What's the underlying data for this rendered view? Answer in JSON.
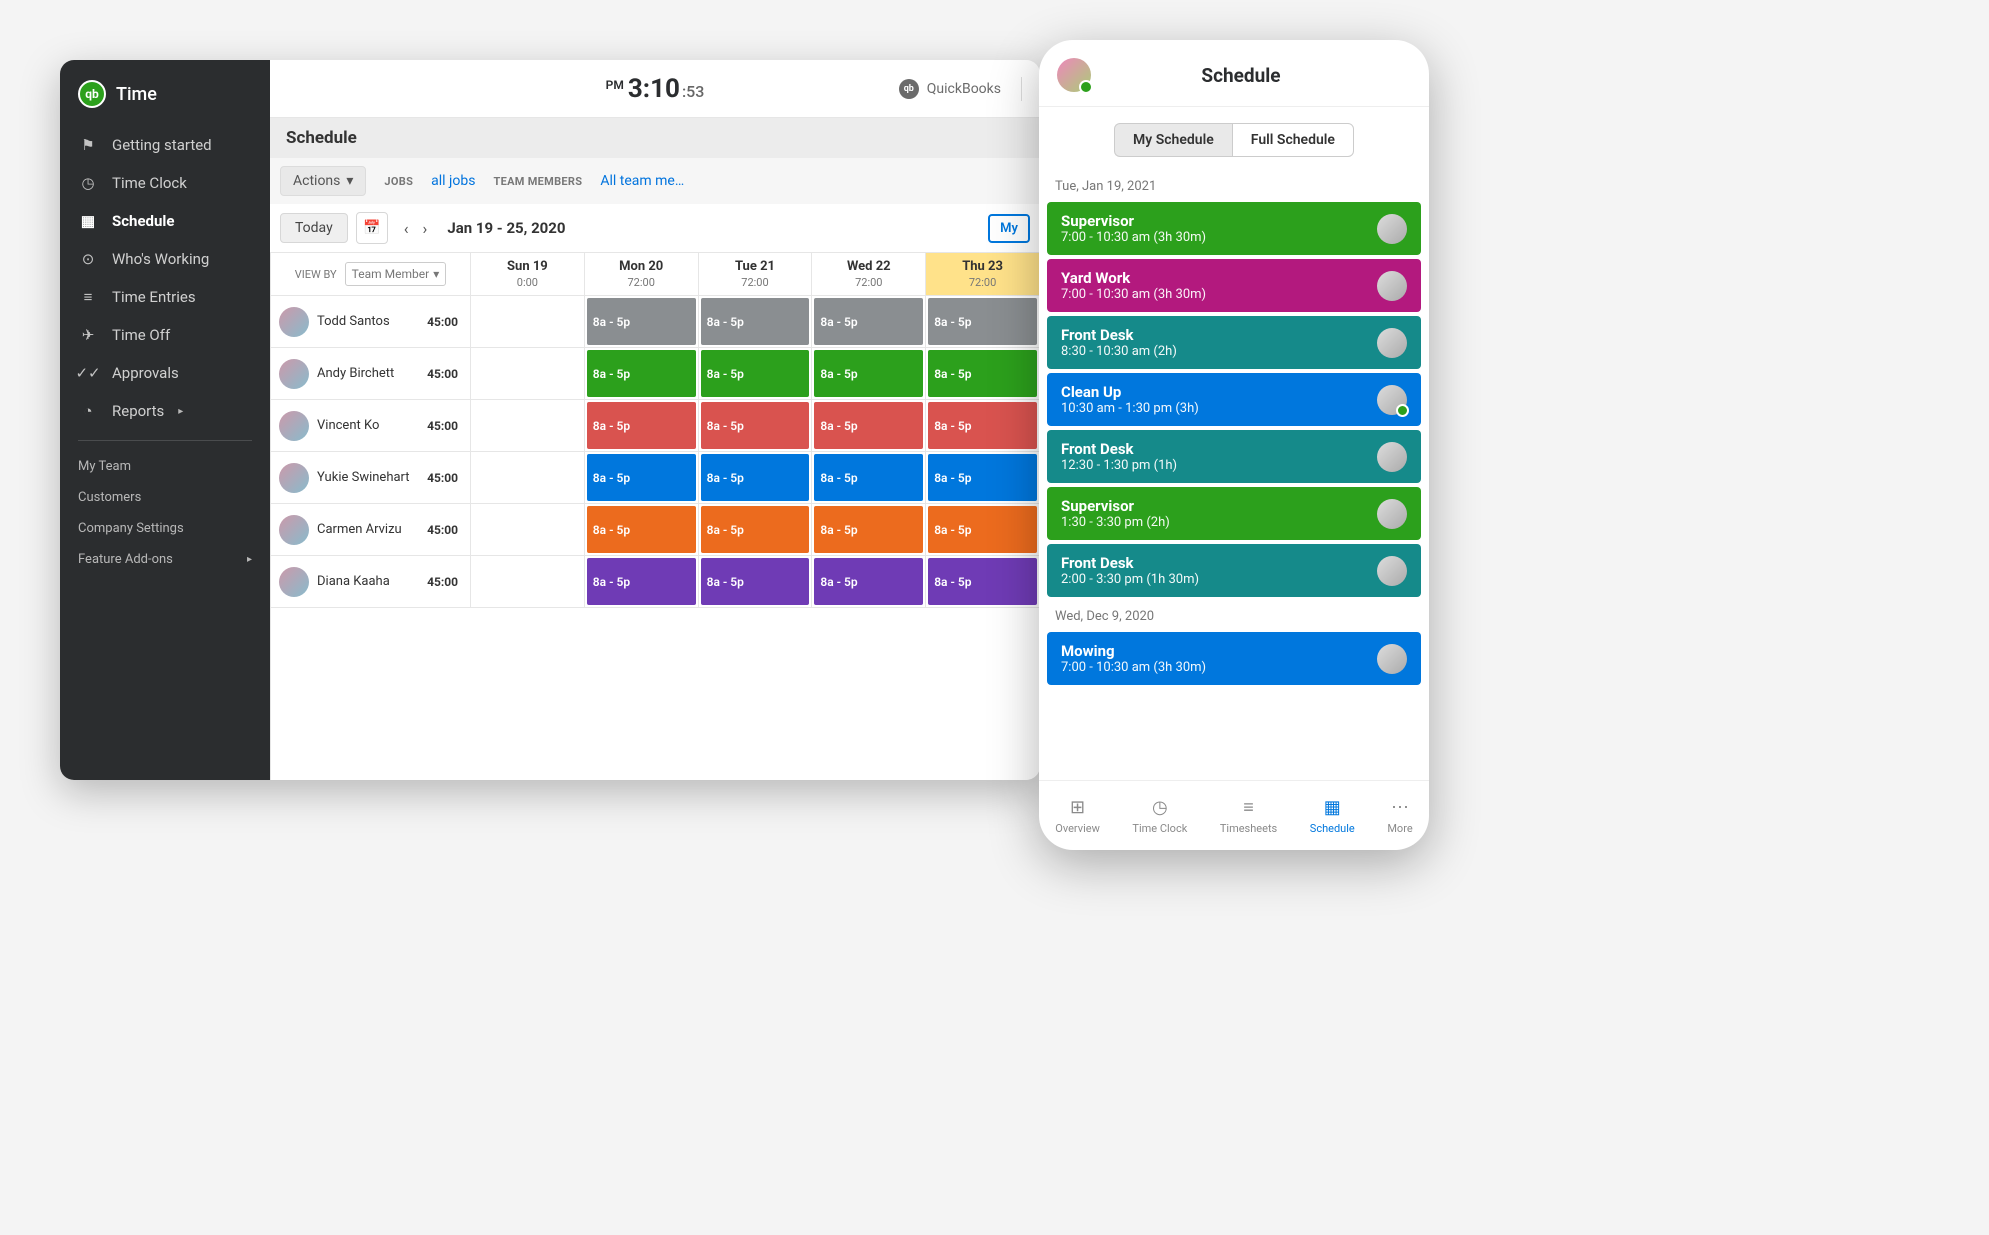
{
  "brand": {
    "name": "Time",
    "badge": "qb"
  },
  "clock": {
    "ampm": "PM",
    "hhmm": "3:10",
    "ss": ":53"
  },
  "topRight": {
    "label": "QuickBooks",
    "badge": "qb"
  },
  "sidebar": {
    "items": [
      {
        "label": "Getting started",
        "icon": "flag-icon"
      },
      {
        "label": "Time Clock",
        "icon": "clock-icon"
      },
      {
        "label": "Schedule",
        "icon": "calendar-icon",
        "active": true
      },
      {
        "label": "Who's Working",
        "icon": "pin-icon"
      },
      {
        "label": "Time Entries",
        "icon": "list-icon"
      },
      {
        "label": "Time Off",
        "icon": "plane-icon"
      },
      {
        "label": "Approvals",
        "icon": "check-icon"
      },
      {
        "label": "Reports",
        "icon": "pie-icon",
        "hasCaret": true
      }
    ],
    "subs": [
      {
        "label": "My Team"
      },
      {
        "label": "Customers"
      },
      {
        "label": "Company Settings"
      },
      {
        "label": "Feature Add-ons",
        "hasCaret": true
      }
    ]
  },
  "page": {
    "title": "Schedule",
    "actions": "Actions",
    "jobsLabel": "JOBS",
    "jobsValue": "all jobs",
    "teamLabel": "TEAM MEMBERS",
    "teamValue": "All team me…",
    "today": "Today",
    "range": "Jan 19 - 25, 2020",
    "viewByLabel": "VIEW BY",
    "viewByValue": "Team Member",
    "myBtn": "My"
  },
  "days": [
    {
      "name": "Sun 19",
      "hours": "0:00"
    },
    {
      "name": "Mon 20",
      "hours": "72:00"
    },
    {
      "name": "Tue 21",
      "hours": "72:00"
    },
    {
      "name": "Wed 22",
      "hours": "72:00"
    },
    {
      "name": "Thu 23",
      "hours": "72:00",
      "today": true
    }
  ],
  "shiftText": "8a - 5p",
  "employees": [
    {
      "name": "Todd Santos",
      "hours": "45:00",
      "color": "c-gray"
    },
    {
      "name": "Andy Birchett",
      "hours": "45:00",
      "color": "c-green"
    },
    {
      "name": "Vincent Ko",
      "hours": "45:00",
      "color": "c-red"
    },
    {
      "name": "Yukie Swinehart",
      "hours": "45:00",
      "color": "c-blue"
    },
    {
      "name": "Carmen Arvizu",
      "hours": "45:00",
      "color": "c-orange"
    },
    {
      "name": "Diana Kaaha",
      "hours": "45:00",
      "color": "c-purple"
    }
  ],
  "mobile": {
    "title": "Schedule",
    "seg": {
      "a": "My Schedule",
      "b": "Full Schedule"
    },
    "groups": [
      {
        "date": "Tue, Jan 19, 2021",
        "cards": [
          {
            "title": "Supervisor",
            "sub": "7:00 - 10:30 am (3h 30m)",
            "color": "c-green"
          },
          {
            "title": "Yard Work",
            "sub": "7:00 - 10:30 am (3h 30m)",
            "color": "c-pink"
          },
          {
            "title": "Front Desk",
            "sub": "8:30 - 10:30 am (2h)",
            "color": "c-teal"
          },
          {
            "title": "Clean Up",
            "sub": "10:30 am - 1:30 pm (3h)",
            "color": "c-blue",
            "online": true
          },
          {
            "title": "Front Desk",
            "sub": "12:30 - 1:30 pm (1h)",
            "color": "c-teal"
          },
          {
            "title": "Supervisor",
            "sub": "1:30 - 3:30 pm (2h)",
            "color": "c-green"
          },
          {
            "title": "Front Desk",
            "sub": "2:00 - 3:30 pm (1h 30m)",
            "color": "c-teal"
          }
        ]
      },
      {
        "date": "Wed, Dec 9, 2020",
        "cards": [
          {
            "title": "Mowing",
            "sub": "7:00 - 10:30 am (3h 30m)",
            "color": "c-blue"
          }
        ]
      }
    ],
    "tabs": [
      {
        "label": "Overview",
        "icon": "⊞"
      },
      {
        "label": "Time Clock",
        "icon": "◷"
      },
      {
        "label": "Timesheets",
        "icon": "≡"
      },
      {
        "label": "Schedule",
        "icon": "▦",
        "active": true
      },
      {
        "label": "More",
        "icon": "⋯"
      }
    ]
  }
}
